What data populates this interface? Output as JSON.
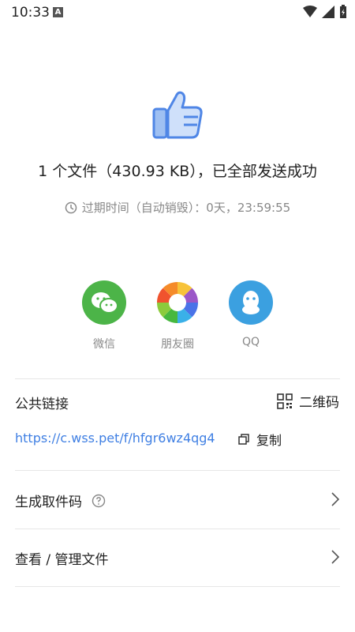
{
  "status": {
    "time": "10:33",
    "a_badge": "A"
  },
  "result": {
    "headline": "1 个文件（430.93 KB），已全部发送成功",
    "expire": "过期时间（自动销毁）：0天，23:59:55"
  },
  "share": [
    {
      "label": "微信",
      "color": "#4cb448"
    },
    {
      "label": "朋友圈",
      "color": "#ffffff"
    },
    {
      "label": "QQ",
      "color": "#3ba0e0"
    }
  ],
  "public_link": {
    "title": "公共链接",
    "qr_label": "二维码",
    "url": "https://c.wss.pet/f/hfgr6wz4qg4",
    "copy_label": "复制"
  },
  "rows": [
    {
      "label": "生成取件码"
    },
    {
      "label": "查看 / 管理文件"
    }
  ],
  "colors": {
    "link": "#3f7fe3",
    "accent_thumb": "#4f86e6"
  }
}
